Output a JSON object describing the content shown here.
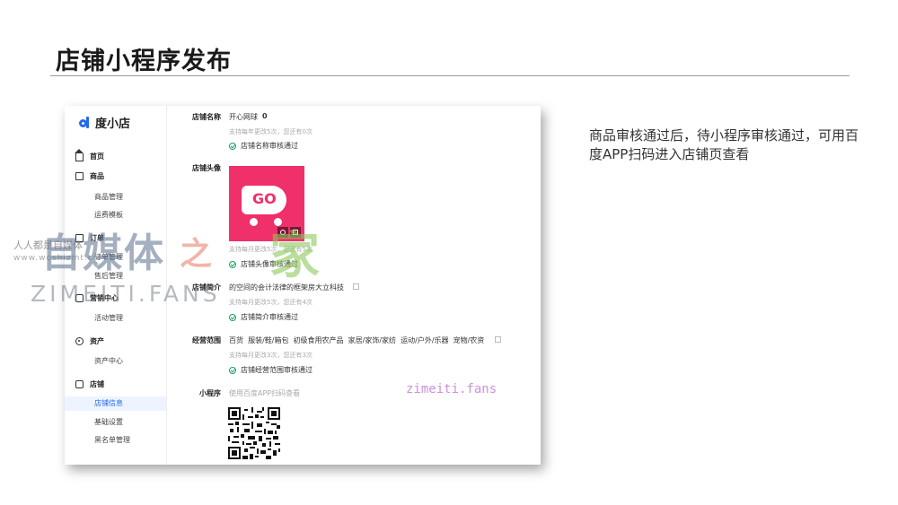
{
  "slide": {
    "title": "店铺小程序发布",
    "note": "商品审核通过后，待小程序审核通过，可用百度APP扫码进入店铺页查看"
  },
  "app": {
    "logo_text": "度小店",
    "brand_color": "#2468f2",
    "sidebar": {
      "home": "首页",
      "goods": "商品",
      "goods_manage": "商品管理",
      "freight_template": "运费模板",
      "orders": "订单",
      "order_manage": "订单管理",
      "aftersale_manage": "售后管理",
      "marketing": "营销中心",
      "activity_manage": "活动管理",
      "assets": "资产",
      "assets_center": "资产中心",
      "store": "店铺",
      "store_info": "店铺信息",
      "basic_settings": "基础设置",
      "blacklist_manage": "黑名单管理"
    },
    "form": {
      "name": {
        "label": "店铺名称",
        "value": "开心网球",
        "count": "0",
        "hint": "支持每年更改5次，您还有0次",
        "status": "店铺名称审核通过"
      },
      "avatar": {
        "label": "店铺头像",
        "image_text": "GO",
        "hint": "支持每月更改5次，您还有5次",
        "status": "店铺头像审核通过"
      },
      "intro": {
        "label": "店铺简介",
        "value": "的空间的会计法律的框架房大立科技",
        "hint": "支持每月更改5次，您还有4次",
        "status": "店铺简介审核通过"
      },
      "scope": {
        "label": "经营范围",
        "value": "百货  服装/鞋/箱包  初级食用农产品  家居/家饰/家纺  运动/户外/乐器  宠物/农资",
        "hint": "支持每月更改3次，您还有3次",
        "status": "店铺经营范围审核通过"
      },
      "miniapp": {
        "label": "小程序",
        "value": "使用百度APP扫码查看"
      }
    }
  },
  "watermarks": {
    "small1": "人人都是自媒体",
    "small2": "www.woshizmt.cn",
    "big": "自媒体",
    "zhi": "之",
    "jia": "家",
    "english": "ZIMEITI.FANS",
    "fans": "zimeiti.fans"
  }
}
